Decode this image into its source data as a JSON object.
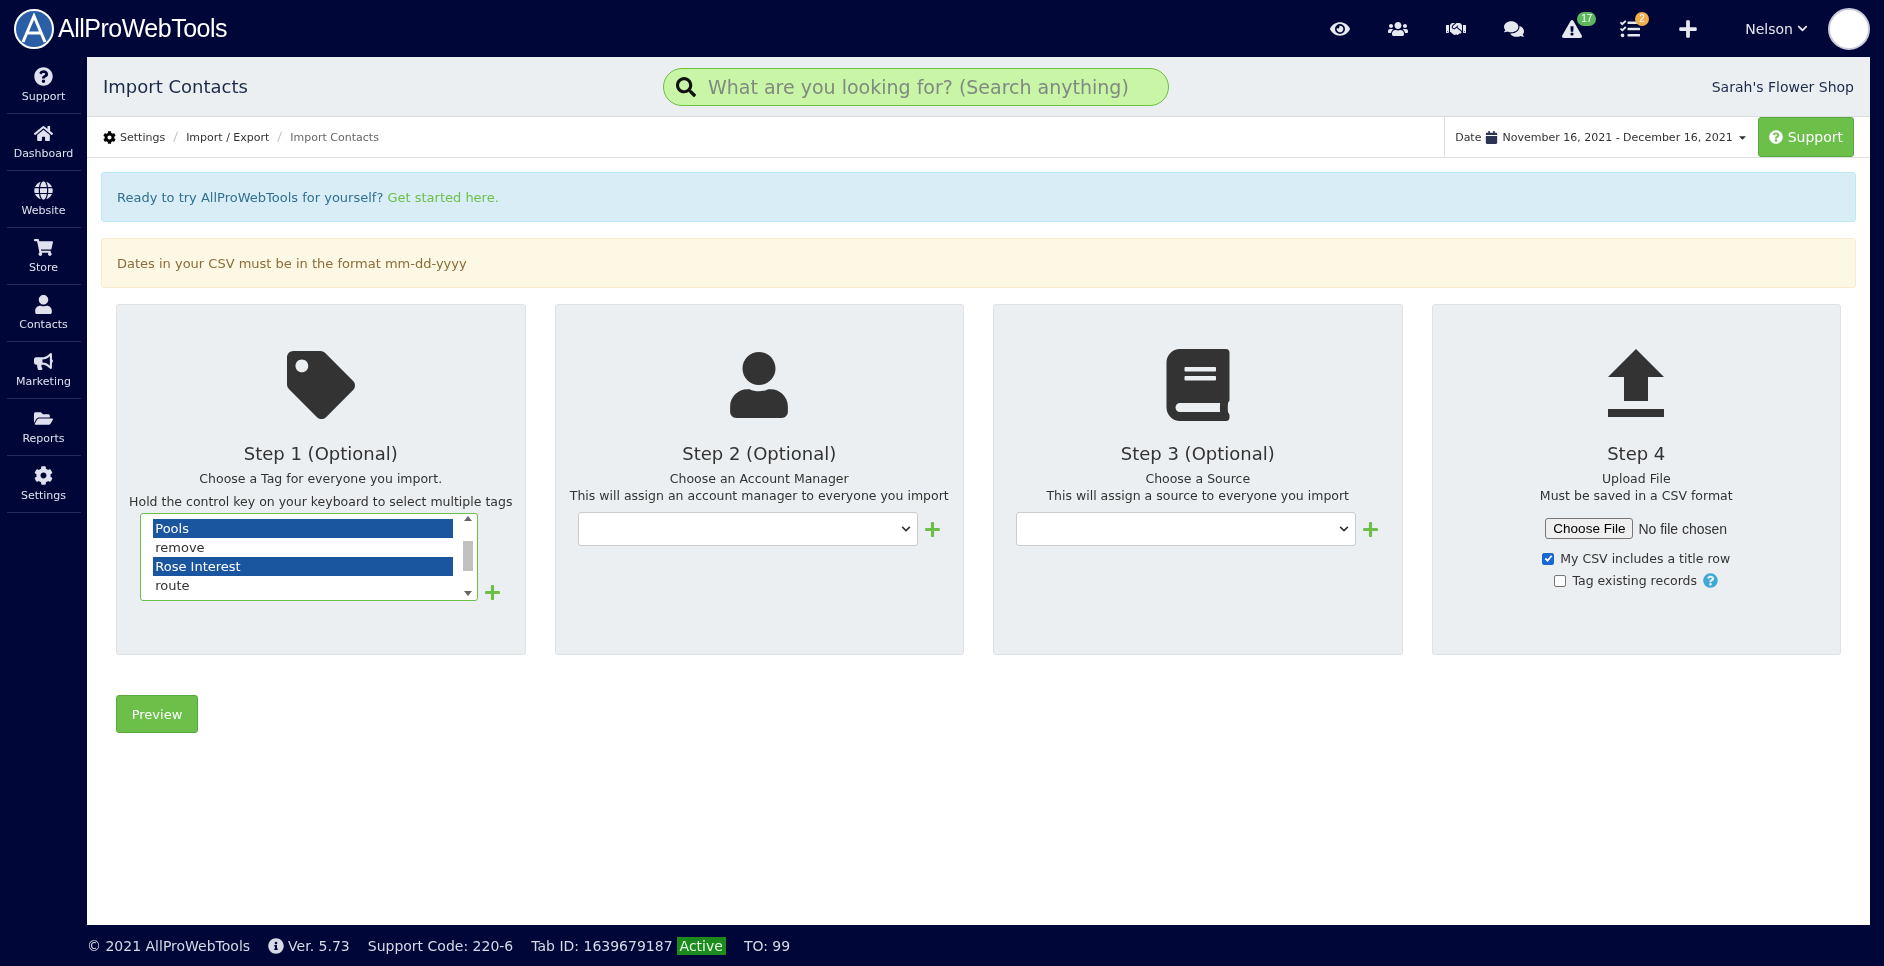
{
  "brand": {
    "name": "AllProWebTools"
  },
  "topbar": {
    "icons": [
      {
        "kind": "eye"
      },
      {
        "kind": "users"
      },
      {
        "kind": "handshake"
      },
      {
        "kind": "comments"
      },
      {
        "kind": "alert",
        "badge": "17",
        "color": "#5cb85c"
      },
      {
        "kind": "tasks",
        "badge": "2",
        "color": "#f0ad4e"
      },
      {
        "kind": "plus"
      }
    ],
    "user": "Nelson"
  },
  "sidebar": {
    "items": [
      {
        "kind": "support",
        "label": "Support"
      },
      {
        "kind": "dashboard",
        "label": "Dashboard"
      },
      {
        "kind": "website",
        "label": "Website"
      },
      {
        "kind": "store",
        "label": "Store"
      },
      {
        "kind": "contacts",
        "label": "Contacts"
      },
      {
        "kind": "marketing",
        "label": "Marketing"
      },
      {
        "kind": "reports",
        "label": "Reports"
      },
      {
        "kind": "settings",
        "label": "Settings"
      }
    ]
  },
  "header": {
    "title": "Import Contacts",
    "search": {
      "placeholder": "What are you looking for? (Search anything)"
    },
    "shop": "Sarah's Flower Shop"
  },
  "breadcrumb": [
    "Settings",
    "Import / Export",
    "Import Contacts"
  ],
  "date": {
    "label": "Date",
    "range": "November 16, 2021 - December 16, 2021"
  },
  "support_button": "Support",
  "alerts": [
    {
      "kind": "info",
      "text": "Ready to try AllProWebTools for yourself?",
      "link": "Get started here."
    },
    {
      "kind": "warning",
      "text": "Dates in your CSV must be in the format mm-dd-yyyy"
    }
  ],
  "steps": [
    {
      "kind": "tags",
      "title": "Step 1 (Optional)",
      "lines": [
        "Choose a Tag for everyone you import.",
        "Hold the control key on your keyboard to select multiple tags"
      ],
      "options": [
        {
          "label": "Pools",
          "selected": true
        },
        {
          "label": "remove",
          "selected": false
        },
        {
          "label": "Rose Interest",
          "selected": true
        },
        {
          "label": "route",
          "selected": false
        }
      ]
    },
    {
      "kind": "select",
      "title": "Step 2 (Optional)",
      "lines": [
        "Choose an Account Manager",
        "This will assign an account manager to everyone you import"
      ]
    },
    {
      "kind": "select",
      "title": "Step 3 (Optional)",
      "lines": [
        "Choose a Source",
        "This will assign a source to everyone you import"
      ]
    },
    {
      "kind": "upload",
      "title": "Step 4",
      "lines": [
        "Upload File",
        "Must be saved in a CSV format"
      ],
      "file_button": "Choose File",
      "file_status": "No file chosen",
      "checks": [
        {
          "label": "My CSV includes a title row",
          "checked": true,
          "help": false
        },
        {
          "label": "Tag existing records",
          "checked": false,
          "help": true
        }
      ]
    }
  ],
  "preview_button": "Preview",
  "footer": {
    "copyright": "© 2021 AllProWebTools",
    "version": "Ver. 5.73",
    "support_code": "Support Code: 220-6",
    "tab_id": "Tab ID: 1639679187",
    "status": "Active",
    "to": "TO: 99"
  }
}
